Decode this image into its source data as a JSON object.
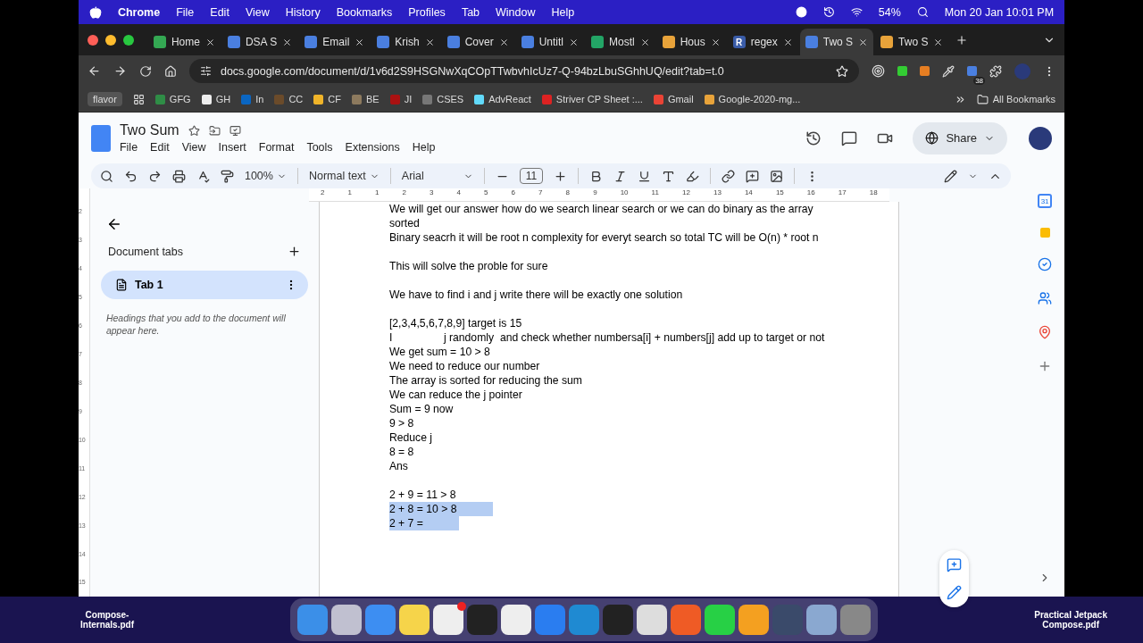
{
  "menubar": {
    "app": "Chrome",
    "menus": [
      "File",
      "Edit",
      "View",
      "History",
      "Bookmarks",
      "Profiles",
      "Tab",
      "Window",
      "Help"
    ],
    "battery": "54%",
    "clock": "Mon 20 Jan  10:01 PM"
  },
  "tabs": [
    {
      "title": "Home",
      "kind": "drive",
      "selected": false
    },
    {
      "title": "DSA S",
      "kind": "docs",
      "selected": false
    },
    {
      "title": "Email",
      "kind": "docs",
      "selected": false
    },
    {
      "title": "Krish",
      "kind": "docs",
      "selected": false
    },
    {
      "title": "Cover",
      "kind": "docs",
      "selected": false
    },
    {
      "title": "Untitl",
      "kind": "docs",
      "selected": false
    },
    {
      "title": "Mostl",
      "kind": "sheets",
      "selected": false
    },
    {
      "title": "Hous",
      "kind": "leetcode",
      "selected": false
    },
    {
      "title": "regex",
      "kind": "letter",
      "letter": "R",
      "selected": false
    },
    {
      "title": "Two S",
      "kind": "docs",
      "selected": true
    },
    {
      "title": "Two S",
      "kind": "leetcode",
      "selected": false
    }
  ],
  "address": {
    "url": "docs.google.com/document/d/1v6d2S9HSGNwXqCOpTTwbvhIcUz7-Q-94bzLbuSGhhUQ/edit?tab=t.0",
    "extension_badge": "38"
  },
  "bookmarks": {
    "profile": "flavor",
    "items": [
      "GFG",
      "GH",
      "In",
      "CC",
      "CF",
      "BE",
      "JI",
      "CSES",
      "AdvReact",
      "Striver CP Sheet :...",
      "Gmail",
      "Google-2020-mg..."
    ],
    "all": "All Bookmarks"
  },
  "docs": {
    "title": "Two Sum",
    "menus": [
      "File",
      "Edit",
      "View",
      "Insert",
      "Format",
      "Tools",
      "Extensions",
      "Help"
    ],
    "share": "Share",
    "zoom": "100%",
    "style": "Normal text",
    "font": "Arial",
    "size": "11",
    "calendar_day": "31"
  },
  "ruler": [
    "2",
    "1",
    "1",
    "2",
    "3",
    "4",
    "5",
    "6",
    "7",
    "8",
    "9",
    "10",
    "11",
    "12",
    "13",
    "14",
    "15",
    "16",
    "17",
    "18"
  ],
  "vertical_ruler": [
    "2",
    "3",
    "4",
    "5",
    "6",
    "7",
    "8",
    "9",
    "10",
    "11",
    "12",
    "13",
    "14",
    "15"
  ],
  "sidebar": {
    "heading": "Document tabs",
    "tabs": [
      {
        "label": "Tab 1",
        "selected": true
      }
    ],
    "hint": "Headings that you add to the document will appear here."
  },
  "paragraphs": [
    [
      {
        "text": "We will get our answer how do we search linear search or we can do binary as the array",
        "selected": false
      },
      {
        "text": "sorted",
        "selected": false
      },
      {
        "text": "Binary seacrh it will be root n complexity for everyt search so total TC will be O(n) * root n",
        "selected": false
      }
    ],
    [
      {
        "text": "This will solve the proble for sure",
        "selected": false
      }
    ],
    [
      {
        "text": "We have to find i and j write there will be exactly one solution",
        "selected": false
      }
    ],
    [
      {
        "text": "[2,3,4,5,6,7,8,9] target is 15",
        "selected": false
      },
      {
        "text": "I                 j randomly  and check whether numbersa[i] + numbers[j] add up to target or not",
        "selected": false
      },
      {
        "text": "We get sum = 10 > 8",
        "selected": false
      },
      {
        "text": "We need to reduce our number",
        "selected": false
      },
      {
        "text": "The array is sorted for reducing the sum",
        "selected": false
      },
      {
        "text": "We can reduce the j pointer",
        "selected": false
      },
      {
        "text": "Sum = 9 now",
        "selected": false
      },
      {
        "text": "9 > 8",
        "selected": false
      },
      {
        "text": "Reduce j",
        "selected": false
      },
      {
        "text": "8 = 8",
        "selected": false
      },
      {
        "text": "Ans",
        "selected": false
      }
    ],
    [
      {
        "text": "2 + 9 = 11 > 8",
        "selected": false
      },
      {
        "text": "2 + 8 = 10 > 8",
        "selected": true
      },
      {
        "text": "2 + 7 =",
        "selected": true
      }
    ]
  ],
  "desktop_files": [
    "Compose-\nInternals.pdf",
    "Practical Jetpack\nCompose.pdf"
  ],
  "dock": [
    {
      "kind": "finder"
    },
    {
      "kind": "launchpad"
    },
    {
      "kind": "mail"
    },
    {
      "kind": "notes"
    },
    {
      "kind": "slack",
      "badge": true
    },
    {
      "kind": "terminal"
    },
    {
      "kind": "chatgpt"
    },
    {
      "kind": "xcode"
    },
    {
      "kind": "vscode"
    },
    {
      "kind": "intellij"
    },
    {
      "kind": "chrome"
    },
    {
      "kind": "postman"
    },
    {
      "kind": "whatsapp"
    },
    {
      "kind": "vpn"
    },
    {
      "kind": "quicktime"
    },
    {
      "kind": "preview"
    },
    {
      "kind": "trash"
    }
  ]
}
